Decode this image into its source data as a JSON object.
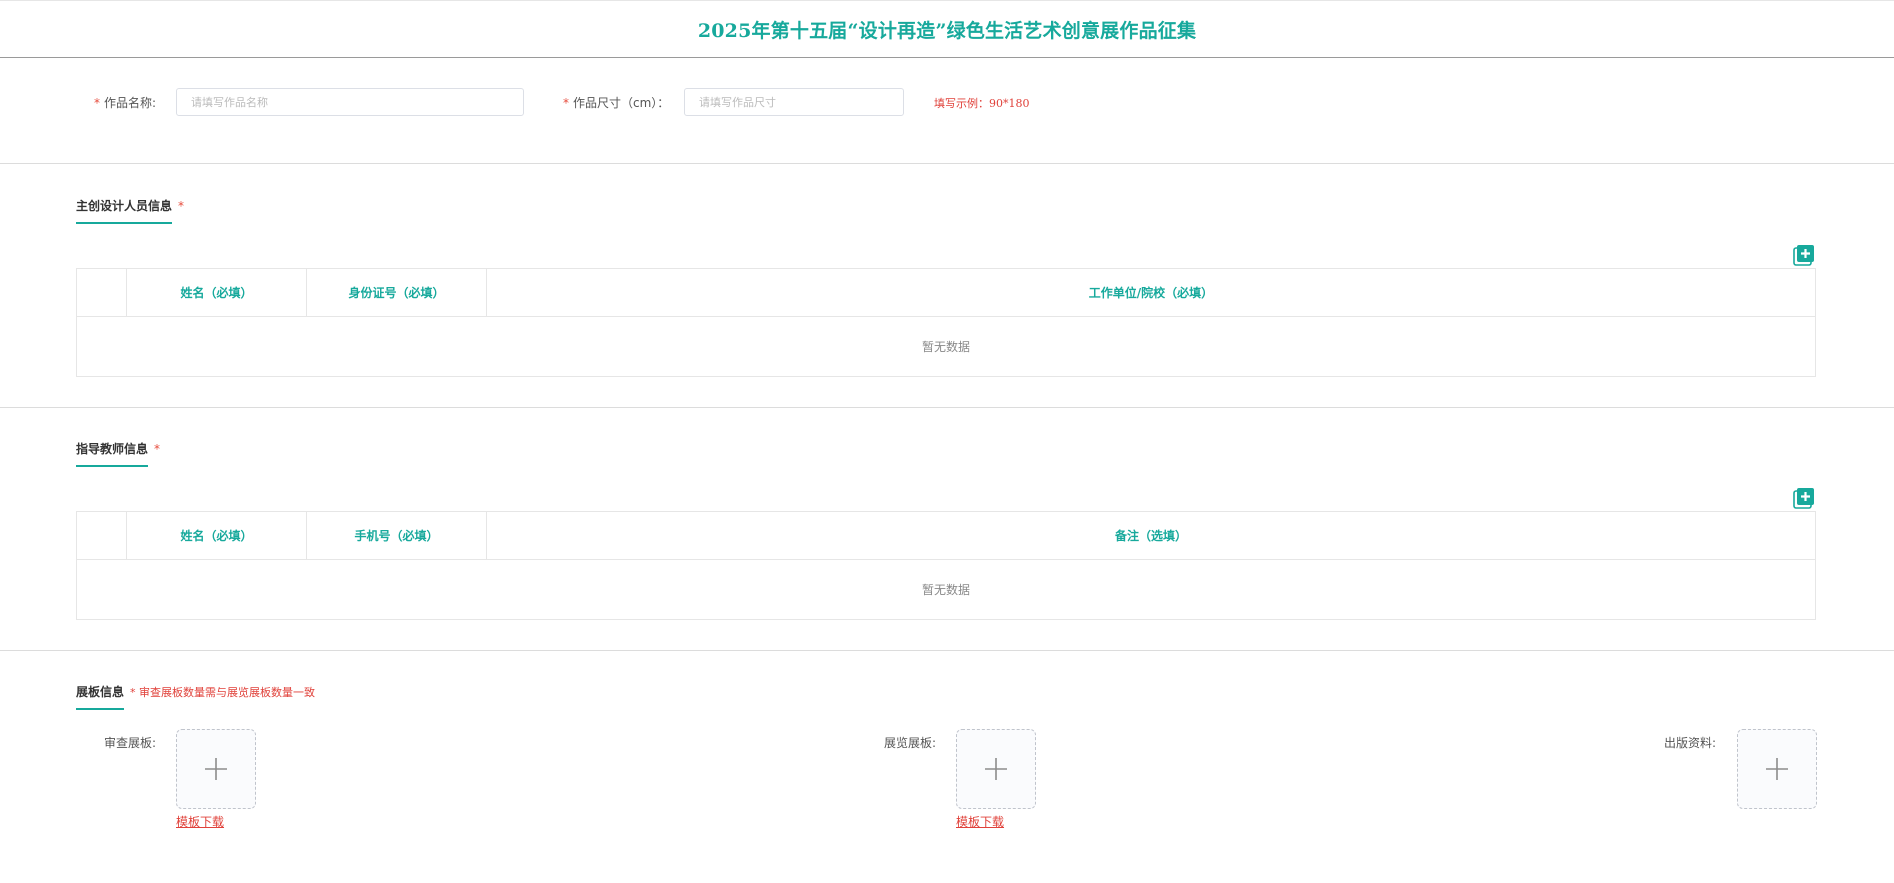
{
  "header": {
    "title": "2025年第十五届“设计再造”绿色生活艺术创意展作品征集"
  },
  "work_form": {
    "name_label": "作品名称:",
    "name_placeholder": "请填写作品名称",
    "name_value": "",
    "size_label": "作品尺寸（cm）：",
    "size_placeholder": "请填写作品尺寸",
    "size_value": "",
    "size_hint": "填写示例：90*180",
    "required_mark": "*"
  },
  "designers": {
    "title": "主创设计人员信息",
    "required_mark": "*",
    "add_icon": "add-square-icon",
    "columns": [
      "",
      "姓名（必填）",
      "身份证号（必填）",
      "工作单位/院校（必填）"
    ],
    "empty_text": "暂无数据"
  },
  "teachers": {
    "title": "指导教师信息",
    "required_mark": "*",
    "add_icon": "add-square-icon",
    "columns": [
      "",
      "姓名（必填）",
      "手机号（必填）",
      "备注（选填）"
    ],
    "empty_text": "暂无数据"
  },
  "boards": {
    "title": "展板信息",
    "note": "* 审查展板数量需与展览展板数量一致",
    "review_label": "审查展板:",
    "exhibit_label": "展览展板:",
    "publish_label": "出版资料:",
    "template_link": "模板下载",
    "upload_icon": "plus-icon"
  },
  "colors": {
    "accent": "#17a99c",
    "danger": "#e0413a",
    "border": "#e6e6e6"
  }
}
